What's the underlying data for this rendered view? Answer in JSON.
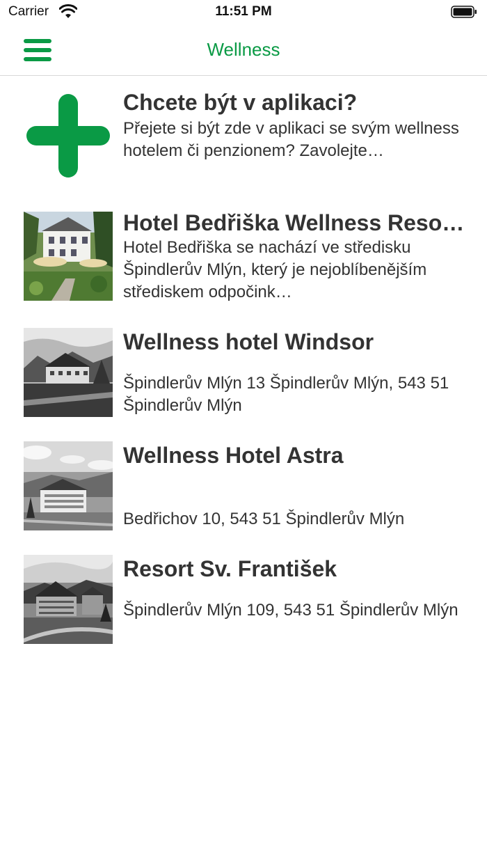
{
  "status_bar": {
    "carrier": "Carrier",
    "time": "11:51 PM"
  },
  "nav": {
    "title": "Wellness",
    "menu_icon": "hamburger-menu-icon"
  },
  "colors": {
    "accent": "#0a9a45",
    "text": "#333333"
  },
  "promo": {
    "title": "Chcete být v aplikaci?",
    "description": "Přejete si být zde v aplikaci se svým wellness hotelem či penzionem? Zavolejte…",
    "icon": "plus-icon"
  },
  "hotels": [
    {
      "name": "Hotel Bedřiška Wellness Reso…",
      "description": "Hotel Bedřiška se nachází ve středisku Špindlerův Mlýn, který je nejoblíbenějším střediskem odpočink…"
    },
    {
      "name": "Wellness hotel Windsor",
      "description": "Špindlerův Mlýn 13 Špindlerův Mlýn, 543 51 Špindlerův Mlýn"
    },
    {
      "name": "Wellness Hotel Astra",
      "description": "Bedřichov 10, 543 51 Špindlerův Mlýn"
    },
    {
      "name": "Resort Sv. František",
      "description": "Špindlerův Mlýn 109, 543 51 Špindlerův Mlýn"
    }
  ]
}
